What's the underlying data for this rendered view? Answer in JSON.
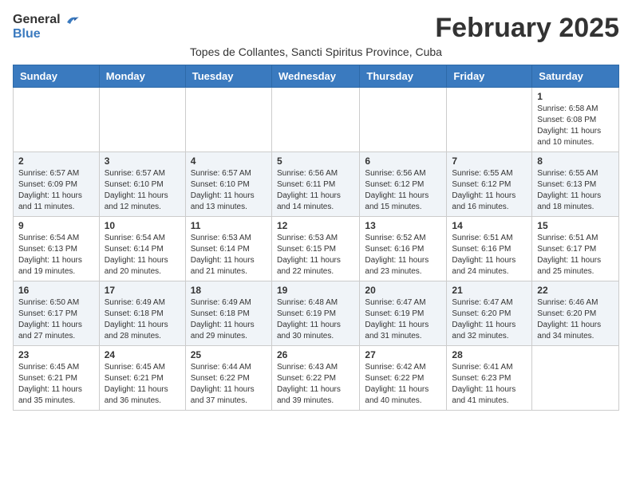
{
  "header": {
    "logo_line1": "General",
    "logo_line2": "Blue",
    "title": "February 2025",
    "subtitle": "Topes de Collantes, Sancti Spiritus Province, Cuba"
  },
  "weekdays": [
    "Sunday",
    "Monday",
    "Tuesday",
    "Wednesday",
    "Thursday",
    "Friday",
    "Saturday"
  ],
  "weeks": [
    [
      {
        "day": "",
        "info": ""
      },
      {
        "day": "",
        "info": ""
      },
      {
        "day": "",
        "info": ""
      },
      {
        "day": "",
        "info": ""
      },
      {
        "day": "",
        "info": ""
      },
      {
        "day": "",
        "info": ""
      },
      {
        "day": "1",
        "info": "Sunrise: 6:58 AM\nSunset: 6:08 PM\nDaylight: 11 hours\nand 10 minutes."
      }
    ],
    [
      {
        "day": "2",
        "info": "Sunrise: 6:57 AM\nSunset: 6:09 PM\nDaylight: 11 hours\nand 11 minutes."
      },
      {
        "day": "3",
        "info": "Sunrise: 6:57 AM\nSunset: 6:10 PM\nDaylight: 11 hours\nand 12 minutes."
      },
      {
        "day": "4",
        "info": "Sunrise: 6:57 AM\nSunset: 6:10 PM\nDaylight: 11 hours\nand 13 minutes."
      },
      {
        "day": "5",
        "info": "Sunrise: 6:56 AM\nSunset: 6:11 PM\nDaylight: 11 hours\nand 14 minutes."
      },
      {
        "day": "6",
        "info": "Sunrise: 6:56 AM\nSunset: 6:12 PM\nDaylight: 11 hours\nand 15 minutes."
      },
      {
        "day": "7",
        "info": "Sunrise: 6:55 AM\nSunset: 6:12 PM\nDaylight: 11 hours\nand 16 minutes."
      },
      {
        "day": "8",
        "info": "Sunrise: 6:55 AM\nSunset: 6:13 PM\nDaylight: 11 hours\nand 18 minutes."
      }
    ],
    [
      {
        "day": "9",
        "info": "Sunrise: 6:54 AM\nSunset: 6:13 PM\nDaylight: 11 hours\nand 19 minutes."
      },
      {
        "day": "10",
        "info": "Sunrise: 6:54 AM\nSunset: 6:14 PM\nDaylight: 11 hours\nand 20 minutes."
      },
      {
        "day": "11",
        "info": "Sunrise: 6:53 AM\nSunset: 6:14 PM\nDaylight: 11 hours\nand 21 minutes."
      },
      {
        "day": "12",
        "info": "Sunrise: 6:53 AM\nSunset: 6:15 PM\nDaylight: 11 hours\nand 22 minutes."
      },
      {
        "day": "13",
        "info": "Sunrise: 6:52 AM\nSunset: 6:16 PM\nDaylight: 11 hours\nand 23 minutes."
      },
      {
        "day": "14",
        "info": "Sunrise: 6:51 AM\nSunset: 6:16 PM\nDaylight: 11 hours\nand 24 minutes."
      },
      {
        "day": "15",
        "info": "Sunrise: 6:51 AM\nSunset: 6:17 PM\nDaylight: 11 hours\nand 25 minutes."
      }
    ],
    [
      {
        "day": "16",
        "info": "Sunrise: 6:50 AM\nSunset: 6:17 PM\nDaylight: 11 hours\nand 27 minutes."
      },
      {
        "day": "17",
        "info": "Sunrise: 6:49 AM\nSunset: 6:18 PM\nDaylight: 11 hours\nand 28 minutes."
      },
      {
        "day": "18",
        "info": "Sunrise: 6:49 AM\nSunset: 6:18 PM\nDaylight: 11 hours\nand 29 minutes."
      },
      {
        "day": "19",
        "info": "Sunrise: 6:48 AM\nSunset: 6:19 PM\nDaylight: 11 hours\nand 30 minutes."
      },
      {
        "day": "20",
        "info": "Sunrise: 6:47 AM\nSunset: 6:19 PM\nDaylight: 11 hours\nand 31 minutes."
      },
      {
        "day": "21",
        "info": "Sunrise: 6:47 AM\nSunset: 6:20 PM\nDaylight: 11 hours\nand 32 minutes."
      },
      {
        "day": "22",
        "info": "Sunrise: 6:46 AM\nSunset: 6:20 PM\nDaylight: 11 hours\nand 34 minutes."
      }
    ],
    [
      {
        "day": "23",
        "info": "Sunrise: 6:45 AM\nSunset: 6:21 PM\nDaylight: 11 hours\nand 35 minutes."
      },
      {
        "day": "24",
        "info": "Sunrise: 6:45 AM\nSunset: 6:21 PM\nDaylight: 11 hours\nand 36 minutes."
      },
      {
        "day": "25",
        "info": "Sunrise: 6:44 AM\nSunset: 6:22 PM\nDaylight: 11 hours\nand 37 minutes."
      },
      {
        "day": "26",
        "info": "Sunrise: 6:43 AM\nSunset: 6:22 PM\nDaylight: 11 hours\nand 39 minutes."
      },
      {
        "day": "27",
        "info": "Sunrise: 6:42 AM\nSunset: 6:22 PM\nDaylight: 11 hours\nand 40 minutes."
      },
      {
        "day": "28",
        "info": "Sunrise: 6:41 AM\nSunset: 6:23 PM\nDaylight: 11 hours\nand 41 minutes."
      },
      {
        "day": "",
        "info": ""
      }
    ]
  ]
}
